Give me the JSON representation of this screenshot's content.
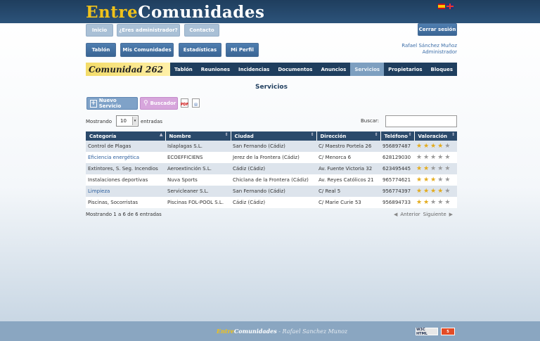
{
  "header": {
    "logo_part1": "Entre",
    "logo_part2": "Comunidades"
  },
  "nav_top": {
    "inicio": "Inicio",
    "admin": "¿Eres administrador?",
    "contacto": "Contacto",
    "logout": "Cerrar sesión"
  },
  "nav_main": {
    "tablon": "Tablón",
    "comunidades": "Mis Comunidades",
    "estadisticas": "Estadísticas",
    "perfil": "Mi Perfil"
  },
  "user": {
    "name": "Rafael Sánchez Muñoz",
    "role": "Administrador"
  },
  "community": {
    "name": "Comunidad 262",
    "tabs": [
      "Tablón",
      "Reuniones",
      "Incidencias",
      "Documentos",
      "Anuncios",
      "Servicios",
      "Propietarios",
      "Bloques"
    ]
  },
  "page_title": "Servicios",
  "toolbar": {
    "new_label": "Nuevo Servicio",
    "search_label": "Buscador"
  },
  "list": {
    "show_label": "Mostrando",
    "entries_value": "10",
    "entries_label": "entradas",
    "search_label": "Buscar:",
    "info": "Mostrando 1 a 6 de 6 entradas",
    "prev": "Anterior",
    "next": "Siguiente"
  },
  "table": {
    "headers": [
      "Categoría",
      "Nombre",
      "Ciudad",
      "Dirección",
      "Teléfono",
      "Valoración"
    ],
    "rows": [
      {
        "categoria": "Control de Plagas",
        "nombre": "Islaplagas S.L.",
        "ciudad": "San Fernando (Cádiz)",
        "direccion": "C/ Maestro Portela 26",
        "telefono": "956897487",
        "valoracion": 4
      },
      {
        "categoria": "Eficiencia energética",
        "nombre": "ECOEFFICIENS",
        "ciudad": "Jerez de la Frontera (Cádiz)",
        "direccion": "C/ Menorca 6",
        "telefono": "628129030",
        "valoracion": 0
      },
      {
        "categoria": "Extintores, S. Seg. Incendios",
        "nombre": "Aeroextinción S.L.",
        "ciudad": "Cádiz (Cádiz)",
        "direccion": "Av. Fuente Victoria 32",
        "telefono": "623495445",
        "valoracion": 2
      },
      {
        "categoria": "Instalaciones deportivas",
        "nombre": "Nuva Sports",
        "ciudad": "Chiclana de la Frontera (Cádiz)",
        "direccion": "Av. Reyes Católicos 21",
        "telefono": "965774621",
        "valoracion": 3
      },
      {
        "categoria": "Limpieza",
        "nombre": "Servicleaner S.L.",
        "ciudad": "San Fernando (Cádiz)",
        "direccion": "C/ Real 5",
        "telefono": "956774397",
        "valoracion": 4
      },
      {
        "categoria": "Piscinas, Socorristas",
        "nombre": "Piscinas FOL-POOL S.L.",
        "ciudad": "Cádiz (Cádiz)",
        "direccion": "C/ Marie Curie 53",
        "telefono": "956894733",
        "valoracion": 2
      }
    ]
  },
  "footer": {
    "logo_part1": "Entre",
    "logo_part2": "Comunidades",
    "author": " - Rafael Sanchez Munoz",
    "badge_w3c": "W3C HTML",
    "badge_html5": "5"
  },
  "colors": {
    "header_bg": "#1f3e5e",
    "logo_yellow": "#f0c21a",
    "accent_blue": "#3c6ea8",
    "active_tab": "#7d9fc0",
    "star_on": "#e3ab1c"
  }
}
